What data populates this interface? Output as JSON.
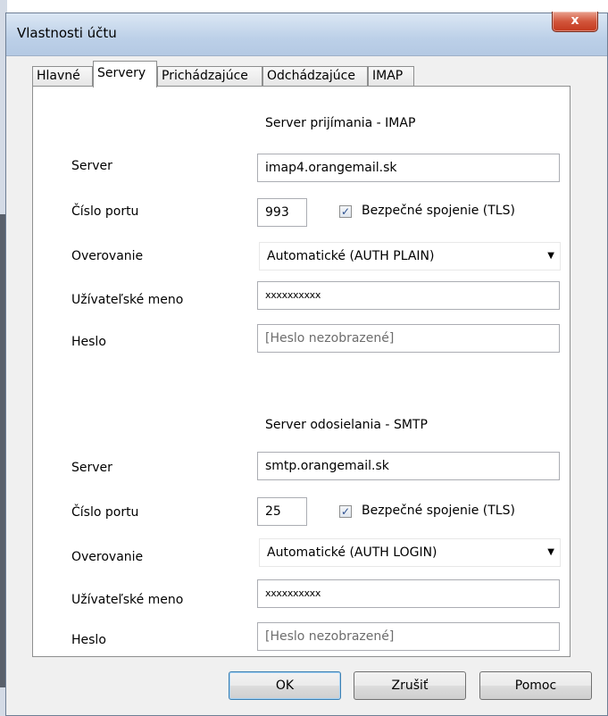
{
  "window": {
    "title": "Vlastnosti účtu",
    "close_glyph": "x"
  },
  "tabs": [
    {
      "label": "Hlavné"
    },
    {
      "label": "Servery"
    },
    {
      "label": "Prichádzajúce"
    },
    {
      "label": "Odchádzajúce"
    },
    {
      "label": "IMAP"
    }
  ],
  "incoming": {
    "section_title": "Server prijímania - IMAP",
    "server_label": "Server",
    "server_value": "imap4.orangemail.sk",
    "port_label": "Číslo portu",
    "port_value": "993",
    "tls_checked": true,
    "tls_label": "Bezpečné spojenie (TLS)",
    "auth_label": "Overovanie",
    "auth_value": "Automatické  (AUTH PLAIN)",
    "user_label": "Užívateľské meno",
    "user_value": "xxxxxxxxxx",
    "password_label": "Heslo",
    "password_placeholder": "[Heslo nezobrazené]"
  },
  "outgoing": {
    "section_title": "Server odosielania - SMTP",
    "server_label": "Server",
    "server_value": "smtp.orangemail.sk",
    "port_label": "Číslo portu",
    "port_value": "25",
    "tls_checked": true,
    "tls_label": "Bezpečné spojenie (TLS)",
    "auth_label": "Overovanie",
    "auth_value": "Automatické  (AUTH LOGIN)",
    "user_label": "Užívateľské meno",
    "user_value": "xxxxxxxxxx",
    "password_label": "Heslo",
    "password_placeholder": "[Heslo nezobrazené]"
  },
  "buttons": {
    "ok": "OK",
    "cancel": "Zrušiť",
    "help": "Pomoc"
  },
  "icons": {
    "checkbox_mark": "✓",
    "dropdown_arrow": "▼"
  }
}
